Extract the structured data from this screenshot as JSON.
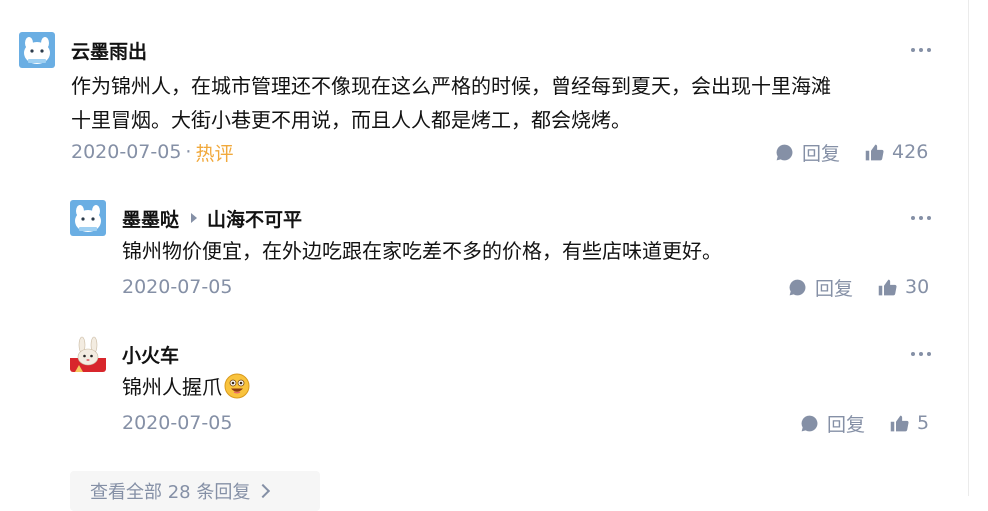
{
  "thread": {
    "comments": [
      {
        "author": "云墨雨出",
        "lines": [
          "作为锦州人，在城市管理还不像现在这么严格的时候，曾经每到夏天，会出现十里海滩",
          "十里冒烟。大街小巷更不用说，而且人人都是烤工，都会烧烤。"
        ],
        "date": "2020-07-05",
        "separator": "·",
        "badge": "热评",
        "reply_label": "回复",
        "likes": "426",
        "avatar_icon": "blue-cartoon-avatar"
      },
      {
        "author": "墨墨哒",
        "reply_to": "山海不可平",
        "lines": [
          "锦州物价便宜，在外边吃跟在家吃差不多的价格，有些店味道更好。"
        ],
        "date": "2020-07-05",
        "reply_label": "回复",
        "likes": "30",
        "avatar_icon": "blue-cartoon-avatar"
      },
      {
        "author": "小火车",
        "lines": [
          "锦州人握爪"
        ],
        "emoji_icon": "grinning-emoji",
        "date": "2020-07-05",
        "reply_label": "回复",
        "likes": "5",
        "avatar_icon": "rabbit-avatar"
      }
    ],
    "view_all_label": "查看全部 28 条回复"
  },
  "colors": {
    "meta_gray": "#8590a6",
    "hot_badge": "#f1a93c",
    "text": "#121212",
    "avatar_blue": "#6aaee3"
  }
}
